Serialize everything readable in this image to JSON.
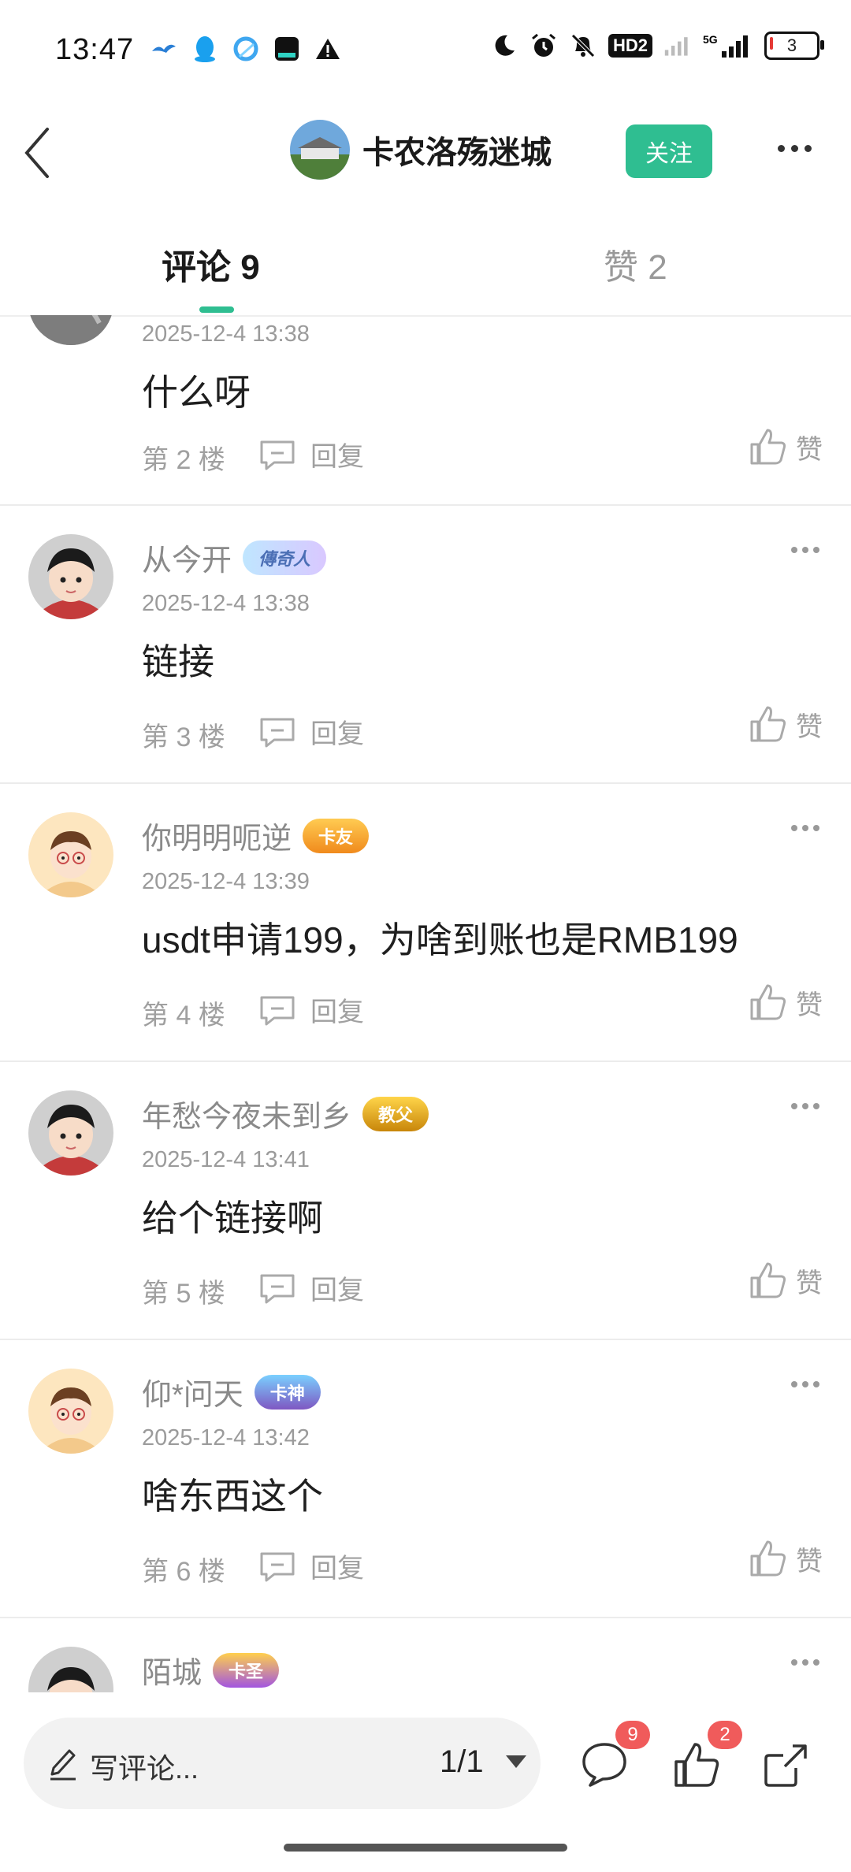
{
  "status_bar": {
    "time": "13:47",
    "network": "5G",
    "hd_label": "HD2",
    "battery": "3"
  },
  "header": {
    "author_name": "卡农洛殇迷城",
    "follow_label": "关注"
  },
  "tabs": {
    "comments_label": "评论 9",
    "likes_label": "赞 2"
  },
  "comments": [
    {
      "time": "2025-12-4 13:38",
      "text": "什么呀",
      "floor": "第 2 楼",
      "reply": "回复",
      "like": "赞"
    },
    {
      "user": "从今开",
      "badge": "傳奇人",
      "time": "2025-12-4 13:38",
      "text": "链接",
      "floor": "第 3 楼",
      "reply": "回复",
      "like": "赞"
    },
    {
      "user": "你明明呃逆",
      "badge": "卡友",
      "time": "2025-12-4 13:39",
      "text": "usdt申请199，为啥到账也是RMB199",
      "floor": "第 4 楼",
      "reply": "回复",
      "like": "赞"
    },
    {
      "user": "年愁今夜未到乡",
      "badge": "教父",
      "time": "2025-12-4 13:41",
      "text": "给个链接啊",
      "floor": "第 5 楼",
      "reply": "回复",
      "like": "赞"
    },
    {
      "user": "仰*问天",
      "badge": "卡神",
      "time": "2025-12-4 13:42",
      "text": "啥东西这个",
      "floor": "第 6 楼",
      "reply": "回复",
      "like": "赞"
    },
    {
      "user": "陌城",
      "badge": "卡圣"
    }
  ],
  "bottom_bar": {
    "compose_placeholder": "写评论...",
    "page_indicator": "1/1",
    "comment_count": "9",
    "like_count": "2"
  },
  "colors": {
    "accent": "#2fbe91",
    "badge_red": "#f05b5b"
  },
  "icons": [
    "back-arrow-icon",
    "more-icon",
    "reply-icon",
    "thumb-up-icon",
    "pen-icon",
    "comment-bubble-icon",
    "share-icon"
  ]
}
